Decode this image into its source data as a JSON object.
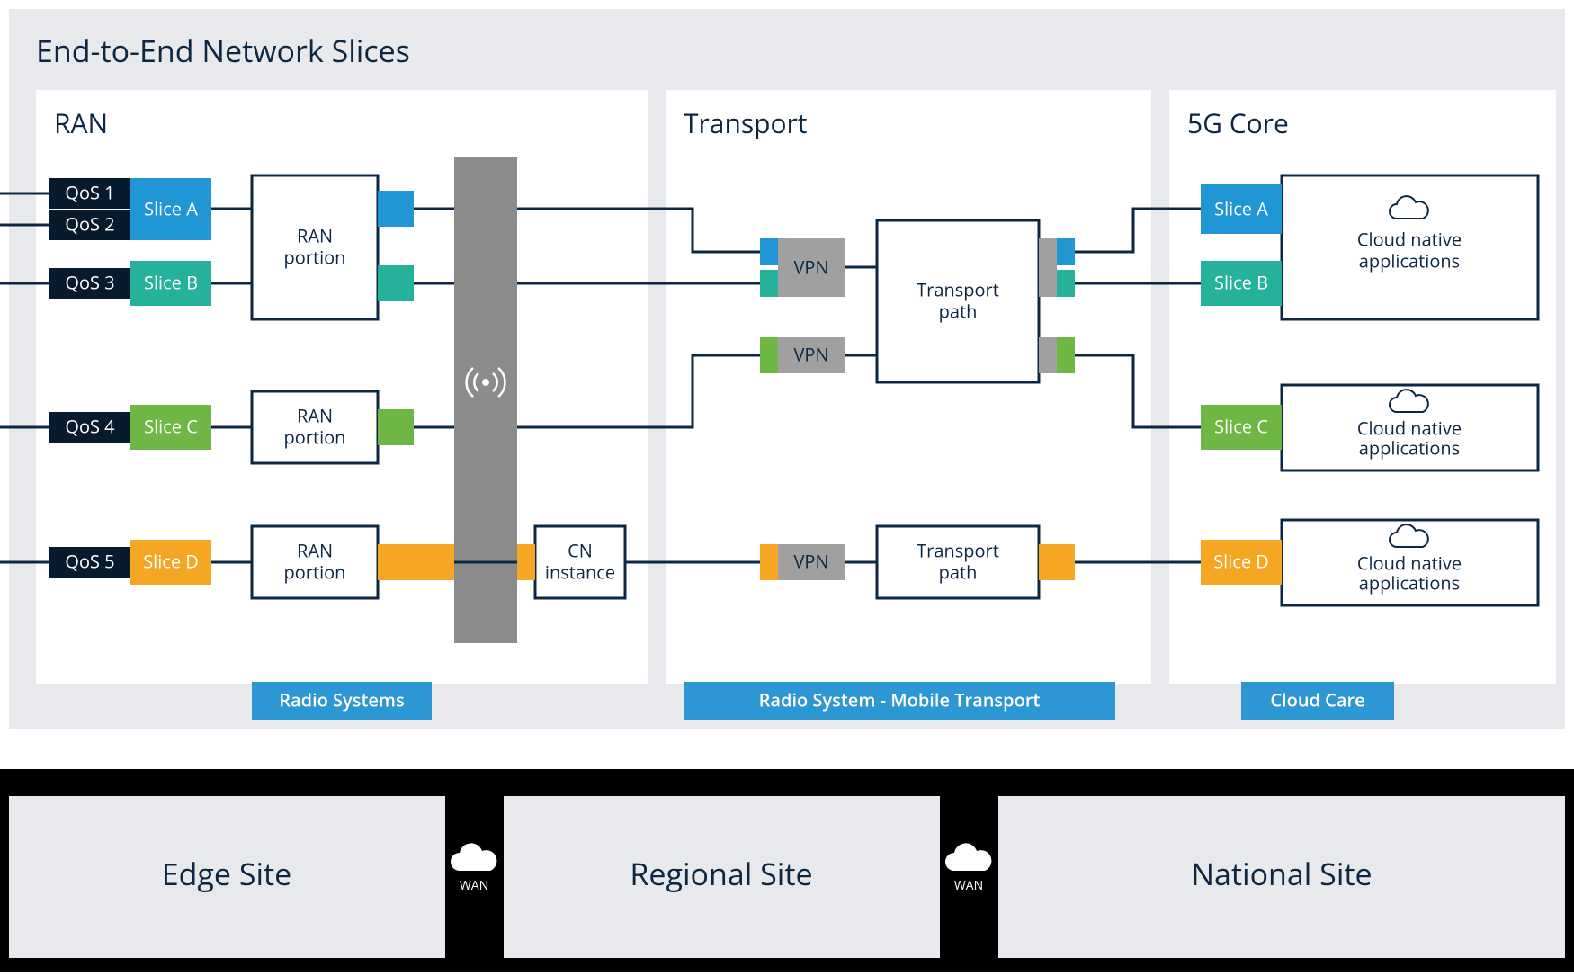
{
  "title": "End-to-End Network Slices",
  "colors": {
    "sliceA": "#2196D5",
    "sliceB": "#26B29A",
    "sliceC": "#6FB744",
    "sliceD": "#F5A623",
    "qos": "#0D2742",
    "antenna": "#8B8B8B",
    "vpn": "#A0A0A0",
    "chip": "#2C97D3"
  },
  "sections": {
    "ran": "RAN",
    "transport": "Transport",
    "core": "5G Core"
  },
  "qos": {
    "q1": "QoS 1",
    "q2": "QoS 2",
    "q3": "QoS 3",
    "q4": "QoS 4",
    "q5": "QoS 5"
  },
  "slices": {
    "a": "Slice A",
    "b": "Slice B",
    "c": "Slice C",
    "d": "Slice D"
  },
  "ran_portion": "RAN",
  "ran_portion2": "portion",
  "cn_instance": "CN",
  "cn_instance2": "instance",
  "vpn": "VPN",
  "transport_path": "Transport",
  "transport_path2": "path",
  "cloud_native": "Cloud native",
  "cloud_native2": "applications",
  "chips": {
    "radio": "Radio Systems",
    "transport": "Radio System - Mobile Transport",
    "care": "Cloud Care"
  },
  "sites": {
    "edge": "Edge Site",
    "regional": "Regional Site",
    "national": "National Site"
  },
  "wan": "WAN"
}
